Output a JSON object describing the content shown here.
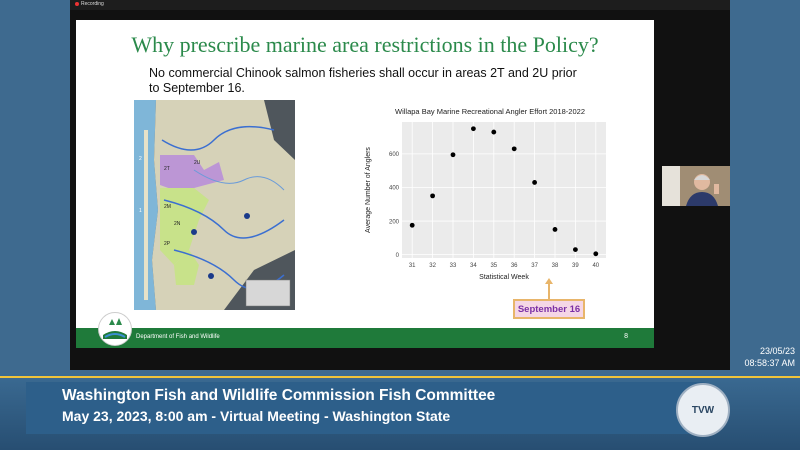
{
  "recording": {
    "label": "Recording"
  },
  "slide": {
    "title": "Why prescribe marine area restrictions in the Policy?",
    "subtitle": "No commercial Chinook salmon fisheries shall occur in areas 2T and 2U prior to September 16.",
    "callout": "September 16",
    "footer": "Department of Fish and Wildlife",
    "page_number": "8",
    "map_labels": [
      "2",
      "2T",
      "2U",
      "2M",
      "2N",
      "2P",
      "1"
    ]
  },
  "chart_data": {
    "type": "scatter",
    "title": "Willapa Bay Marine Recreational Angler Effort 2018-2022",
    "xlabel": "Statistical Week",
    "ylabel": "Average Number of Anglers",
    "x": [
      31,
      32,
      33,
      34,
      35,
      36,
      37,
      38,
      39,
      40
    ],
    "y": [
      175,
      350,
      595,
      750,
      730,
      630,
      430,
      150,
      30,
      5
    ],
    "xlim": [
      30.5,
      40.5
    ],
    "ylim": [
      -20,
      790
    ],
    "yticks": [
      0,
      200,
      400,
      600
    ],
    "grid": true,
    "colors": {
      "point": "#000000",
      "panel": "#ebebeb",
      "grid": "#ffffff"
    }
  },
  "overlay": {
    "date": "23/05/23",
    "time": "08:58:37 AM"
  },
  "banner": {
    "title": "Washington Fish and Wildlife Commission Fish Committee",
    "subtitle": "May 23, 2023, 8:00 am - Virtual Meeting - Washington State",
    "logo": "TVW"
  },
  "colors": {
    "title_green": "#2b8a4b",
    "footer_green": "#1f7a3a",
    "callout_text": "#7b2fa5",
    "banner_blue": "#2d5f8a",
    "accent_gold": "#f0c43a"
  }
}
